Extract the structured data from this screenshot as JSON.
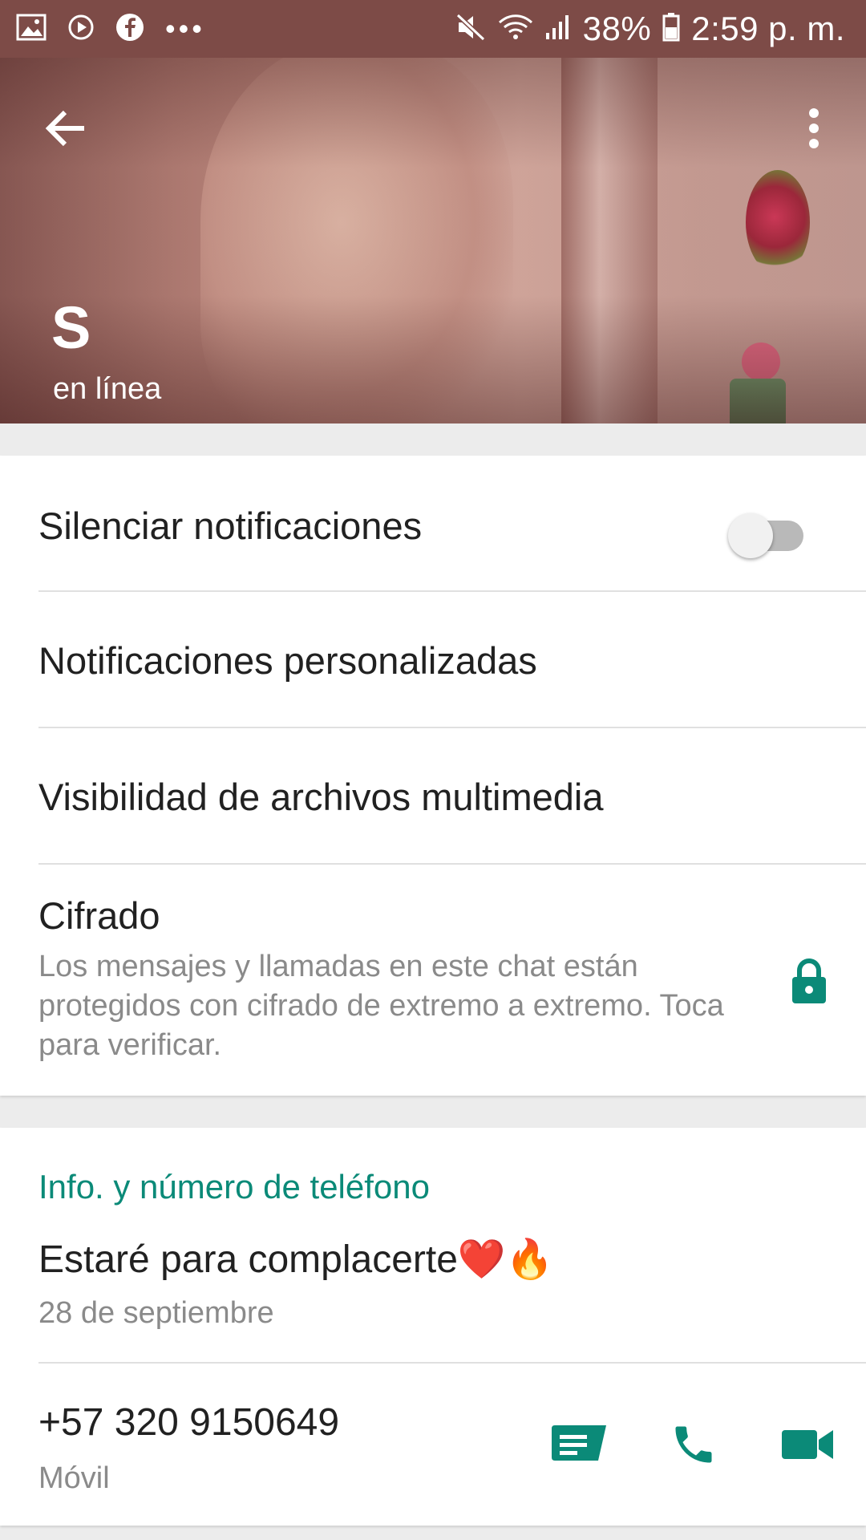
{
  "status_bar": {
    "battery": "38%",
    "time": "2:59 p. m.",
    "left_icons": [
      "gallery-icon",
      "play-icon",
      "facebook-icon",
      "more-dots"
    ],
    "right_icons": [
      "mute-icon",
      "wifi-icon",
      "signal-icon",
      "battery-icon"
    ]
  },
  "header": {
    "name": "S",
    "status": "en línea"
  },
  "settings": {
    "mute": {
      "label": "Silenciar notificaciones",
      "enabled": false
    },
    "custom_notifications": "Notificaciones personalizadas",
    "media_visibility": "Visibilidad de archivos multimedia",
    "encryption": {
      "title": "Cifrado",
      "description": "Los mensajes y llamadas en este chat están protegidos con cifrado de extremo a extremo. Toca para verificar."
    }
  },
  "info": {
    "section_title": "Info. y número de teléfono",
    "about": "Estaré para complacerte❤️🔥",
    "about_date": "28 de septiembre",
    "phone": "+57 320 9150649",
    "phone_type": "Móvil"
  },
  "colors": {
    "accent": "#0b8a78",
    "status_bar": "#7d4b47"
  }
}
